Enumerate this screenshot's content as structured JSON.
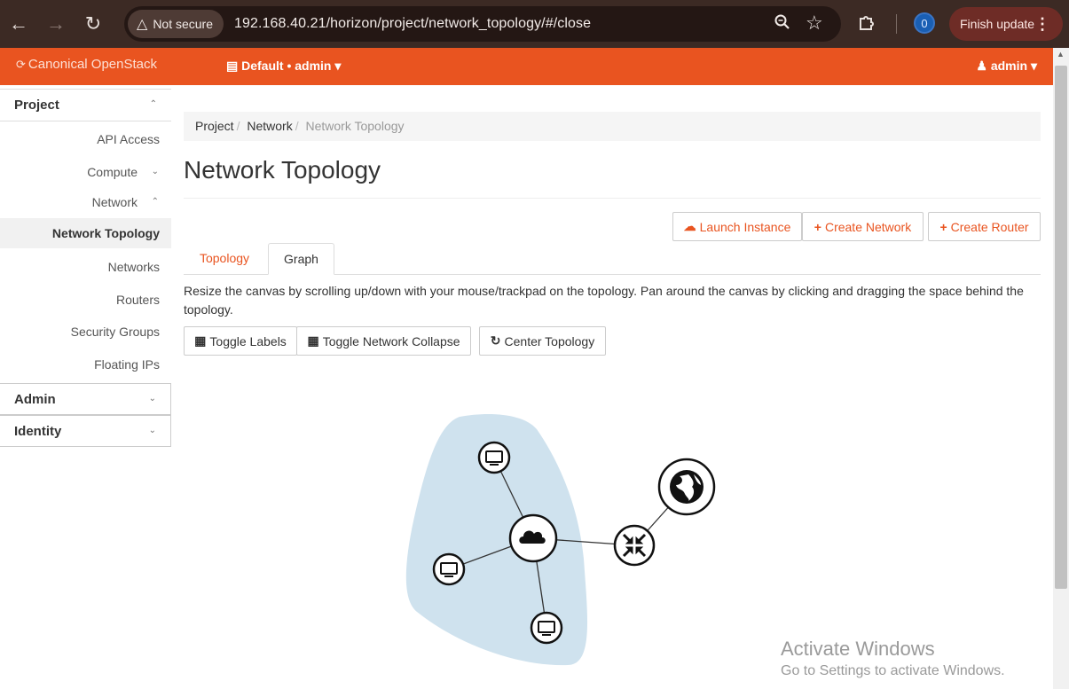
{
  "browser": {
    "security_label": "Not secure",
    "url": "192.168.40.21/horizon/project/network_topology/#/close",
    "profile_badge": "0",
    "finish_update_label": "Finish update"
  },
  "topbar": {
    "brand": "Canonical OpenStack",
    "project_selector": "Default • admin",
    "user_menu": "admin"
  },
  "sidebar": {
    "sections": [
      {
        "label": "Project"
      },
      {
        "label": "Admin"
      },
      {
        "label": "Identity"
      }
    ],
    "items": [
      {
        "label": "API Access"
      },
      {
        "label": "Compute"
      },
      {
        "label": "Network"
      },
      {
        "label": "Network Topology"
      },
      {
        "label": "Networks"
      },
      {
        "label": "Routers"
      },
      {
        "label": "Security Groups"
      },
      {
        "label": "Floating IPs"
      }
    ]
  },
  "breadcrumb": {
    "items": [
      "Project",
      "Network",
      "Network Topology"
    ]
  },
  "page": {
    "title": "Network Topology"
  },
  "actions": {
    "launch_instance": "Launch Instance",
    "create_network": "Create Network",
    "create_router": "Create Router"
  },
  "tabs": [
    {
      "label": "Topology"
    },
    {
      "label": "Graph"
    }
  ],
  "help_text": "Resize the canvas by scrolling up/down with your mouse/trackpad on the topology. Pan around the canvas by clicking and dragging the space behind the topology.",
  "toolbar": {
    "toggle_labels": "Toggle Labels",
    "toggle_collapse": "Toggle Network Collapse",
    "center_topology": "Center Topology"
  },
  "watermark": {
    "line1": "Activate Windows",
    "line2": "Go to Settings to activate Windows."
  },
  "colors": {
    "brand_orange": "#e95420",
    "network_blob": "#cfe2ee",
    "chrome_bg": "#3c2a24"
  }
}
